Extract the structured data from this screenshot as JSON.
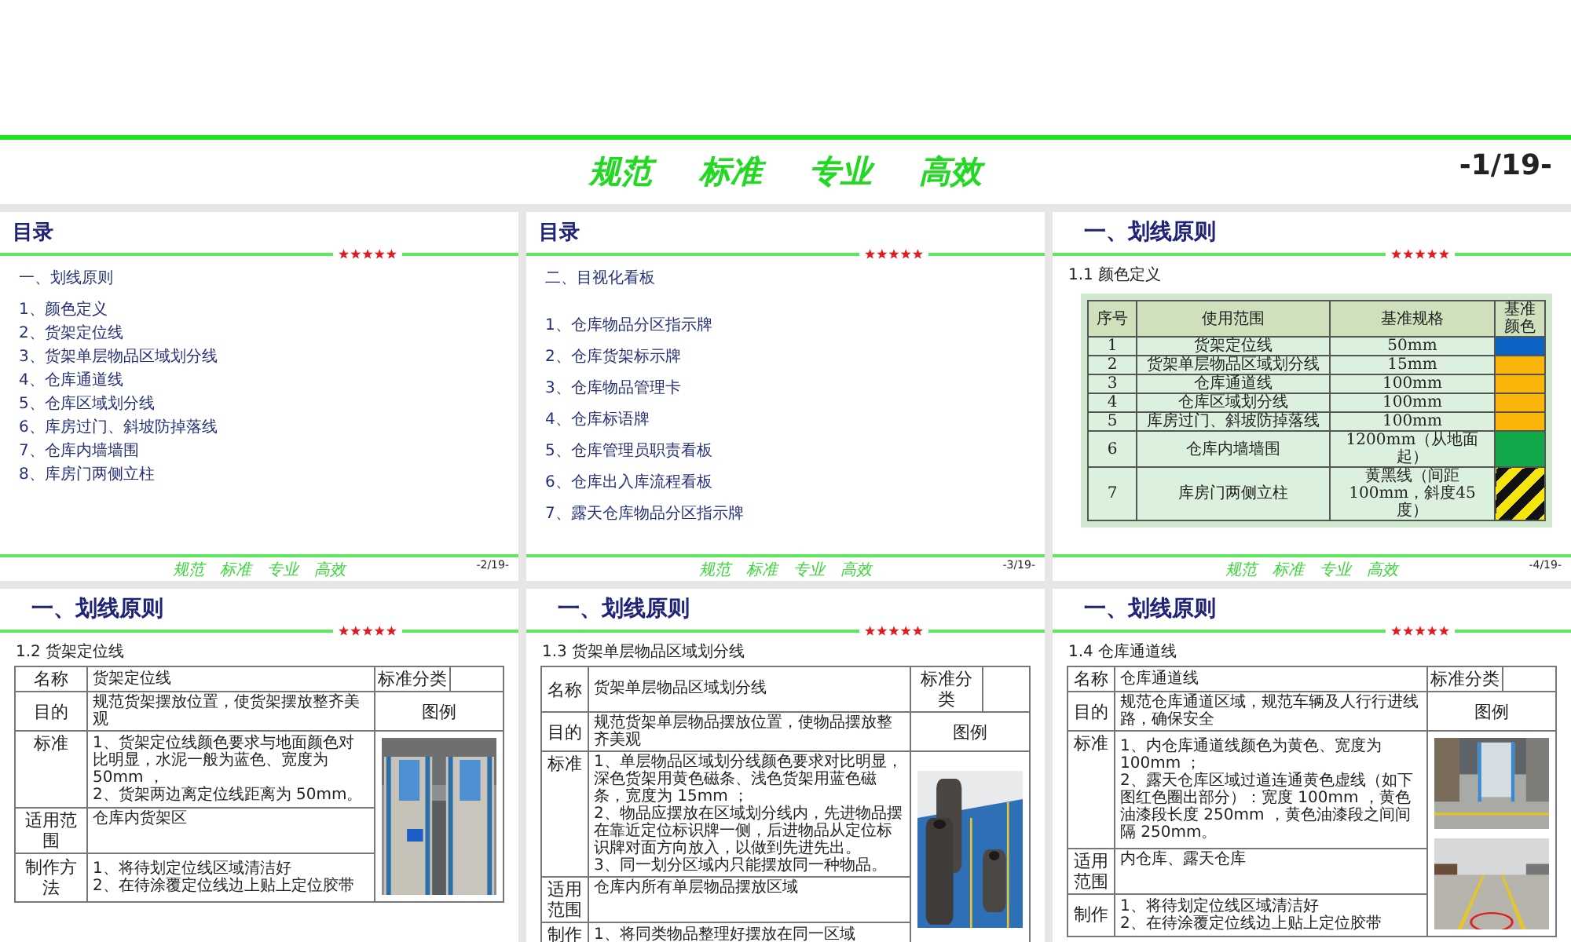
{
  "cover": {
    "slogan": [
      "规范",
      "标准",
      "专业",
      "高效"
    ],
    "page": "-1/19-"
  },
  "slides": [
    {
      "kind": "toc",
      "title": "目录",
      "section": "一、划线原则",
      "items": [
        "1、颜色定义",
        "2、货架定位线",
        "3、货架单层物品区域划分线",
        "4、仓库通道线",
        "5、仓库区域划分线",
        "6、库房过门、斜坡防掉落线",
        "7、仓库内墙墙围",
        "8、库房门两侧立柱"
      ],
      "footer": {
        "slogan": [
          "规范",
          "标准",
          "专业",
          "高效"
        ],
        "page": "-2/19-"
      }
    },
    {
      "kind": "toc",
      "title": "目录",
      "section": "二、目视化看板",
      "items": [
        "1、仓库物品分区指示牌",
        "2、仓库货架标示牌",
        "3、仓库物品管理卡",
        "4、仓库标语牌",
        "5、仓库管理员职责看板",
        "6、仓库出入库流程看板",
        "7、露天仓库物品分区指示牌"
      ],
      "footer": {
        "slogan": [
          "规范",
          "标准",
          "专业",
          "高效"
        ],
        "page": "-3/19-"
      }
    },
    {
      "kind": "colors",
      "title": "一、划线原则",
      "subtitle": "1.1 颜色定义",
      "columns": [
        "序号",
        "使用范围",
        "基准规格",
        "基准颜色"
      ],
      "rows": [
        {
          "no": "1",
          "scope": "货架定位线",
          "spec": "50mm",
          "swatch": {
            "kind": "solid",
            "color": "#0b63c4"
          }
        },
        {
          "no": "2",
          "scope": "货架单层物品区域划分线",
          "spec": "15mm",
          "swatch": {
            "kind": "solid",
            "color": "#fbb40a"
          }
        },
        {
          "no": "3",
          "scope": "仓库通道线",
          "spec": "100mm",
          "swatch": {
            "kind": "solid",
            "color": "#fbb40a"
          }
        },
        {
          "no": "4",
          "scope": "仓库区域划分线",
          "spec": "100mm",
          "swatch": {
            "kind": "solid",
            "color": "#fbb40a"
          }
        },
        {
          "no": "5",
          "scope": "库房过门、斜坡防掉落线",
          "spec": "100mm",
          "swatch": {
            "kind": "solid",
            "color": "#fbb40a"
          }
        },
        {
          "no": "6",
          "scope": "仓库内墙墙围",
          "spec": "1200mm（从地面起）",
          "swatch": {
            "kind": "solid",
            "color": "#12a84a"
          }
        },
        {
          "no": "7",
          "scope": "库房门两侧立柱",
          "spec": "黄黑线（间距100mm，斜度45度）",
          "swatch": {
            "kind": "stripes"
          }
        }
      ],
      "footer": {
        "slogan": [
          "规范",
          "标准",
          "专业",
          "高效"
        ],
        "page": "-4/19-"
      }
    },
    {
      "kind": "spec",
      "title": "一、划线原则",
      "subtitle": "1.2 货架定位线",
      "name_label": "名称",
      "name": "货架定位线",
      "category_label": "标准分类",
      "purpose_label": "目的",
      "purpose": "规范货架摆放位置，使货架摆放整齐美观",
      "legend_label": "图例",
      "standard_label": "标准",
      "standard": [
        "1、货架定位线颜色要求与地面颜色对比明显，水泥一般为蓝色、宽度为 50mm ，",
        "2、货架两边离定位线距离为 50mm。"
      ],
      "scope_label": "适用范围",
      "scope": "仓库内货架区",
      "method_label": "制作方法",
      "method": [
        "1、将待划定位线区域清洁好",
        "2、在待涂覆定位线边上贴上定位胶带"
      ],
      "pictures": [
        {
          "kind": "picture"
        }
      ]
    },
    {
      "kind": "spec",
      "title": "一、划线原则",
      "subtitle": "1.3 货架单层物品区域划分线",
      "name_label": "名称",
      "name": "货架单层物品区域划分线",
      "category_label": "标准分类",
      "purpose_label": "目的",
      "purpose": "规范货架单层物品摆放位置，使物品摆放整齐美观",
      "legend_label": "图例",
      "standard_label": "标准",
      "standard": [
        "1、单层物品区域划分线颜色要求对比明显，深色货架用黄色磁条、浅色货架用蓝色磁条，宽度为 15mm ；",
        "2、物品应摆放在区域划分线内，先进物品摆在靠近定位标识牌一侧，后进物品从定位标识牌对面方向放入，以做到先进先出。",
        "3、同一划分区域内只能摆放同一种物品。"
      ],
      "scope_label": "适用范围",
      "scope": "仓库内所有单层物品摆放区域",
      "method_label": "制作",
      "method": [
        "1、将同类物品整理好摆放在同一区域"
      ],
      "pictures": [
        {
          "kind": "picture"
        }
      ]
    },
    {
      "kind": "spec",
      "title": "一、划线原则",
      "subtitle": "1.4 仓库通道线",
      "name_label": "名称",
      "name": "仓库通道线",
      "category_label": "标准分类",
      "purpose_label": "目的",
      "purpose": "规范仓库通道区域，规范车辆及人行行进线路，确保安全",
      "legend_label": "图例",
      "standard_label": "标准",
      "standard": [
        "1、内仓库通道线颜色为黄色、宽度为 100mm ；",
        "2、露天仓库区域过道连通黄色虚线（如下图红色圈出部分）：宽度 100mm ，黄色油漆段长度 250mm ，黄色油漆段之间间隔 250mm。"
      ],
      "scope_label": "适用范围",
      "scope": "内仓库、露天仓库",
      "method_label": "制作",
      "method": [
        "1、将待划定位线区域清洁好",
        "2、在待涂覆定位线边上贴上定位胶带"
      ],
      "pictures": [
        {
          "kind": "picture"
        },
        {
          "kind": "picture"
        }
      ]
    }
  ]
}
